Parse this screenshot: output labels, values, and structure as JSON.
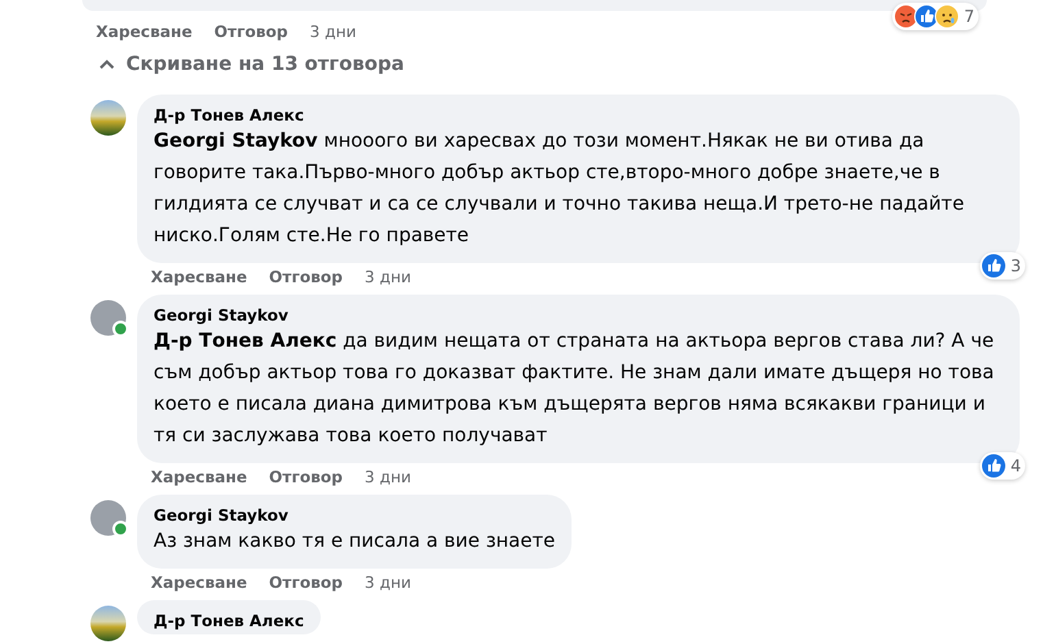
{
  "top_comment": {
    "actions": [
      "Харесване",
      "Отговор"
    ],
    "time": "3 дни",
    "reactions": {
      "kinds": [
        {
          "kind": "angry"
        },
        {
          "kind": "like"
        },
        {
          "kind": "sad"
        }
      ],
      "count": "7"
    }
  },
  "toggle": {
    "label": "Скриване на 13 отговора",
    "expanded": true
  },
  "comments": [
    {
      "author": "Д-р Тонев Алекс",
      "avatar": {
        "kind": "landscape"
      },
      "online": false,
      "text": "**Georgi Staykov** мнооого ви харесвах до този момент.Някак не ви отива да говорите така.Първо-много добър актьор сте,второ-много добре знаете,че в гилдията се случват и са се случвали и точно такива неща.И трето-не падайте ниско.Голям сте.Не го правете",
      "reactions": {
        "kinds": [
          {
            "kind": "like"
          }
        ],
        "count": "3"
      },
      "actions": [
        "Харесване",
        "Отговор"
      ],
      "time": "3 дни"
    },
    {
      "author": "Georgi Staykov",
      "avatar": {
        "kind": "photo"
      },
      "online": true,
      "text": "**Д-р Тонев Алекс** да видим нещата от страната на актьора вергов става ли? А че съм добър актьор това го доказват фактите. Не знам дали имате дъщеря но това което е писала диана димитрова към дъщерята вергов няма всякакви граници и тя си заслужава това което получават",
      "reactions": {
        "kinds": [
          {
            "kind": "like"
          }
        ],
        "count": "4"
      },
      "actions": [
        "Харесване",
        "Отговор"
      ],
      "time": "3 дни"
    },
    {
      "author": "Georgi Staykov",
      "avatar": {
        "kind": "photo"
      },
      "online": true,
      "text": "Аз знам какво тя е писала а вие знаете",
      "actions": [
        "Харесване",
        "Отговор"
      ],
      "time": "3 дни"
    },
    {
      "author": "Д-р Тонев Алекс",
      "avatar": {
        "kind": "landscape"
      },
      "online": false
    }
  ]
}
